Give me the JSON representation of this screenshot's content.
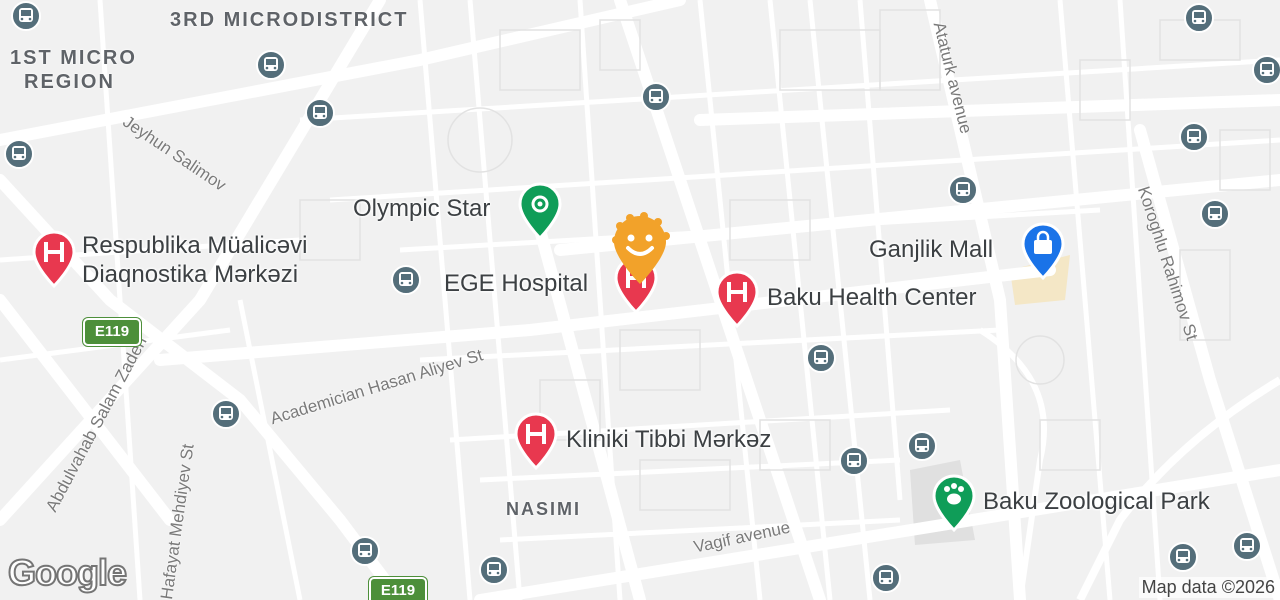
{
  "districts": {
    "third_micro": "3RD MICRODISTRICT",
    "first_micro_1": "1ST MICRO",
    "first_micro_2": "REGION",
    "nasimi": "NASIMI"
  },
  "streets": {
    "jeyhun": "Jeyhun Salimov",
    "academician": "Academician Hasan Aliyev St",
    "abdulvahab": "Abdulvahab Salam Zadeh",
    "fayat": "Hafayat Mehdiyev St",
    "ataturk": "Ataturk avenue",
    "koroghlu": "Koroghlu Rahimov St",
    "vagif": "Vagif avenue"
  },
  "pois": {
    "olympic": "Olympic Star",
    "ege": "EGE Hospital",
    "respublika_1": "Respublika Müalicəvi",
    "respublika_2": "Diaqnostika Mərkəzi",
    "baku_health": "Baku Health Center",
    "ganjlik": "Ganjlik Mall",
    "kliniki": "Kliniki Tibbi Mərkəz",
    "zoo": "Baku Zoological Park"
  },
  "shields": {
    "e119_a": "E119",
    "e119_b": "E119"
  },
  "branding": {
    "logo": "Google",
    "attribution": "Map data ©2026"
  },
  "colors": {
    "hospital": "#e8384f",
    "park": "#0f9d58",
    "mall": "#1a73e8",
    "bus": "#546e7a",
    "selected": "#f2a22a"
  }
}
